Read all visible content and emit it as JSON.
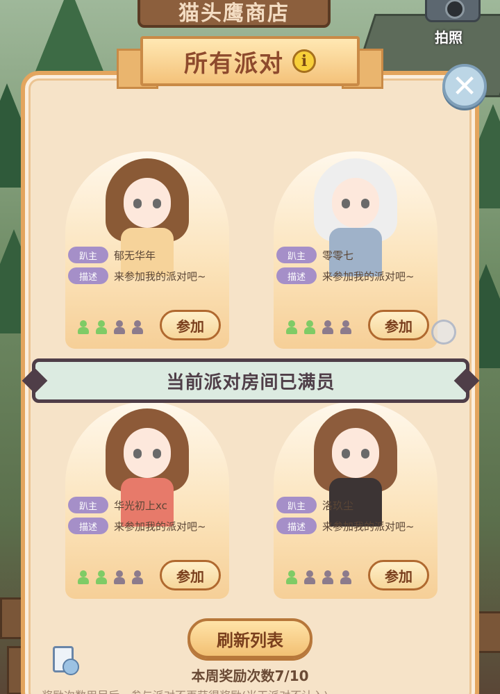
{
  "header": {
    "shop_sign": "猫头鹰商店",
    "camera_label": "拍照",
    "title": "所有派对",
    "info_glyph": "i"
  },
  "close_glyph": "✕",
  "labels": {
    "host_tag": "趴主",
    "desc_tag": "描述",
    "join_label": "参加"
  },
  "parties": [
    {
      "host": "郁无华年",
      "desc": "来参加我的派对吧~",
      "members": 2,
      "capacity": 4,
      "hair_color": "#8a5a36",
      "outfit_color": "#f6d39a"
    },
    {
      "host": "零零七",
      "desc": "来参加我的派对吧~",
      "members": 2,
      "capacity": 4,
      "hair_color": "#eeeeee",
      "outfit_color": "#9fb2c9"
    },
    {
      "host": "华光初上xc",
      "desc": "来参加我的派对吧~",
      "members": 2,
      "capacity": 4,
      "hair_color": "#8d5a38",
      "outfit_color": "#e77a6a"
    },
    {
      "host": "洛玖尘",
      "desc": "来参加我的派对吧~",
      "members": 1,
      "capacity": 4,
      "hair_color": "#8d5c3c",
      "outfit_color": "#3c3434"
    }
  ],
  "toast": "当前派对房间已满员",
  "refresh_label": "刷新列表",
  "reward_text": "本周奖励次数7/10",
  "footer_note": "奖励次数用尽后，参与派对不再获得奖励(当天派对不计入)",
  "colors": {
    "tag": "#a58fc8",
    "slot_filled": "#7fcb66",
    "slot_empty": "#8c7b8c",
    "panel_border": "#e3a55e"
  },
  "icons": [
    "info-icon",
    "close-icon",
    "camera-icon",
    "member-icon",
    "notebook-sad-icon"
  ]
}
